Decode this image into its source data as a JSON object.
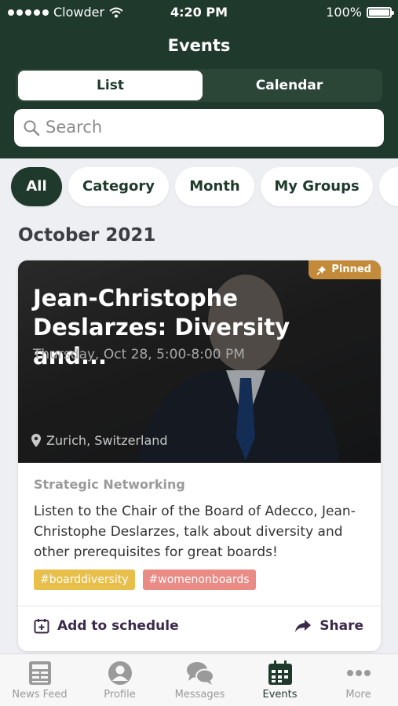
{
  "status_bar": {
    "carrier": "Clowder",
    "time": "4:20 PM",
    "battery": "100%"
  },
  "header": {
    "title": "Events"
  },
  "segmented": {
    "list": "List",
    "calendar": "Calendar"
  },
  "search": {
    "placeholder": "Search"
  },
  "filters": [
    "All",
    "Category",
    "Month",
    "My Groups"
  ],
  "section": {
    "month": "October 2021"
  },
  "event": {
    "pinned": "Pinned",
    "title": "Jean-Christophe Deslarzes: Diversity and...",
    "datetime": "Thursday, Oct 28, 5:00-8:00 PM",
    "location": "Zurich, Switzerland",
    "category": "Strategic Networking",
    "description": "Listen to the Chair of the Board of Adecco, Jean-Christophe Deslarzes, talk about diversity and other prerequisites for great boards!",
    "tags": [
      "#boarddiversity",
      "#womenonboards"
    ],
    "add_label": "Add to schedule",
    "share_label": "Share"
  },
  "tabbar": {
    "items": [
      "News Feed",
      "Profile",
      "Messages",
      "Events",
      "More"
    ],
    "active": "Events"
  },
  "colors": {
    "primary": "#1f3a2c",
    "pinned": "#c38a3a",
    "tag_yellow": "#e7bf4a",
    "tag_red": "#ea8b86"
  }
}
